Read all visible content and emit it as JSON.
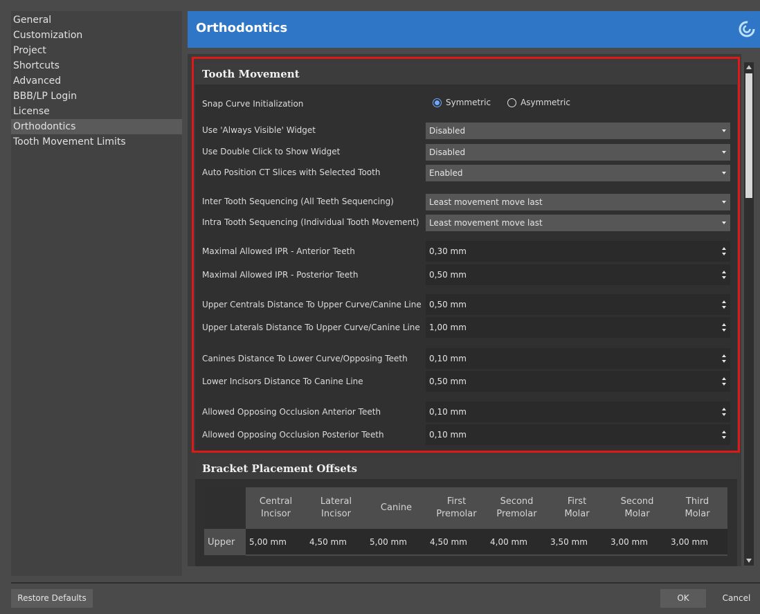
{
  "sidebar": {
    "items": [
      {
        "label": "General"
      },
      {
        "label": "Customization"
      },
      {
        "label": "Project"
      },
      {
        "label": "Shortcuts"
      },
      {
        "label": "Advanced"
      },
      {
        "label": "BBB/LP Login"
      },
      {
        "label": "License"
      },
      {
        "label": "Orthodontics",
        "active": true
      },
      {
        "label": "Tooth Movement Limits"
      }
    ]
  },
  "header": {
    "title": "Orthodontics",
    "logo_icon": "swirl-logo-icon",
    "accent_color": "#2f77c6"
  },
  "tooth_movement": {
    "title": "Tooth Movement",
    "snap_curve": {
      "label": "Snap Curve Initialization",
      "options": [
        "Symmetric",
        "Asymmetric"
      ],
      "selected": "Symmetric"
    },
    "always_visible": {
      "label": "Use 'Always Visible' Widget",
      "value": "Disabled"
    },
    "double_click": {
      "label": "Use Double Click to Show Widget",
      "value": "Disabled"
    },
    "auto_position": {
      "label": "Auto Position CT Slices with Selected Tooth",
      "value": "Enabled"
    },
    "inter_seq": {
      "label": "Inter Tooth Sequencing (All Teeth Sequencing)",
      "value": "Least movement move last"
    },
    "intra_seq": {
      "label": "Intra Tooth Sequencing (Individual Tooth Movement)",
      "value": "Least movement move last"
    },
    "ipr_anterior": {
      "label": "Maximal Allowed IPR - Anterior Teeth",
      "value": "0,30 mm"
    },
    "ipr_posterior": {
      "label": "Maximal Allowed IPR - Posterior Teeth",
      "value": "0,50 mm"
    },
    "upper_centrals": {
      "label": "Upper Centrals Distance To Upper Curve/Canine Line",
      "value": "0,50 mm"
    },
    "upper_laterals": {
      "label": "Upper Laterals Distance To Upper Curve/Canine Line",
      "value": "1,00 mm"
    },
    "canines": {
      "label": "Canines Distance To Lower Curve/Opposing Teeth",
      "value": "0,10 mm"
    },
    "lower_incisors": {
      "label": "Lower Incisors Distance To Canine Line",
      "value": "0,50 mm"
    },
    "occl_anterior": {
      "label": "Allowed Opposing Occlusion Anterior Teeth",
      "value": "0,10 mm"
    },
    "occl_posterior": {
      "label": "Allowed Opposing Occlusion Posterior Teeth",
      "value": "0,10 mm"
    }
  },
  "bracket": {
    "title": "Bracket Placement Offsets",
    "columns": [
      [
        "Central",
        "Incisor"
      ],
      [
        "Lateral",
        "Incisor"
      ],
      [
        "Canine",
        ""
      ],
      [
        "First",
        "Premolar"
      ],
      [
        "Second",
        "Premolar"
      ],
      [
        "First",
        "Molar"
      ],
      [
        "Second",
        "Molar"
      ],
      [
        "Third",
        "Molar"
      ]
    ],
    "rows": [
      {
        "label": "Upper",
        "values": [
          "5,00 mm",
          "4,50 mm",
          "5,00 mm",
          "4,50 mm",
          "4,00 mm",
          "3,50 mm",
          "3,00 mm",
          "3,00 mm"
        ]
      }
    ]
  },
  "footer": {
    "restore_label": "Restore Defaults",
    "ok_label": "OK",
    "cancel_label": "Cancel"
  },
  "highlight_color": "#e01818"
}
